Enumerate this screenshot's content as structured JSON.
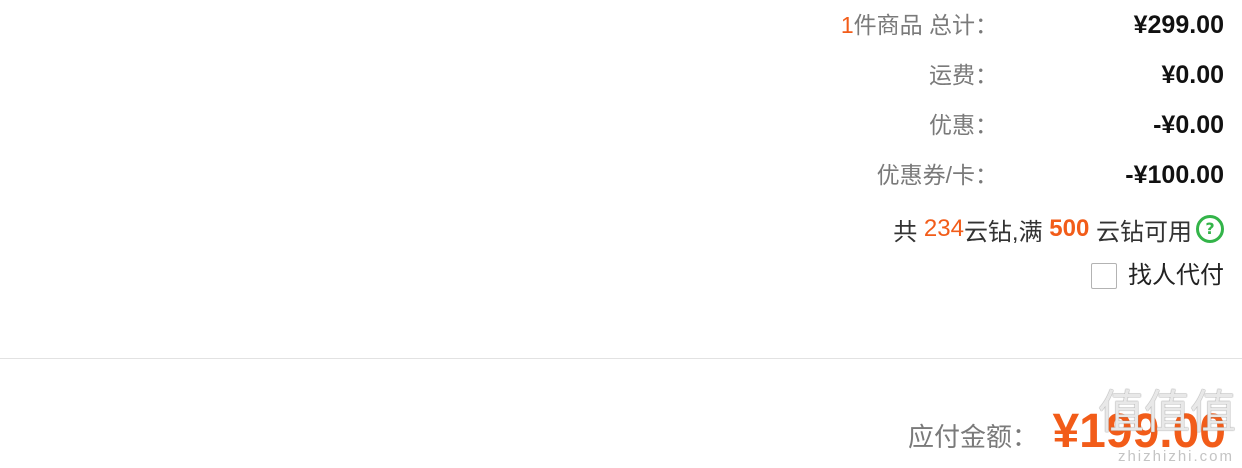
{
  "summary": {
    "item_count": "1",
    "total_label": "件商品 总计：",
    "total_value": "¥299.00",
    "shipping_label": "运费：",
    "shipping_value": "¥0.00",
    "discount_label": "优惠：",
    "discount_value": "-¥0.00",
    "coupon_label": "优惠券/卡：",
    "coupon_value": "-¥100.00"
  },
  "cloud_diamond": {
    "prefix": "共 ",
    "balance": "234",
    "middle": "云钻,满 ",
    "threshold": "500",
    "suffix": " 云钻可用",
    "help_icon": "question-circle-icon"
  },
  "pay_for_me": {
    "label": "找人代付",
    "checked": false
  },
  "payable": {
    "label": "应付金额：",
    "amount": "¥199.00"
  },
  "watermark": {
    "glyphs": "值值值",
    "site": "zhizhizhi.com"
  },
  "colors": {
    "accent": "#f25c19",
    "help": "#33b449",
    "label": "#7a7a7a",
    "text": "#222222",
    "value": "#111111",
    "divider": "#e2e2e2",
    "checkbox": "#b3b3b3"
  }
}
